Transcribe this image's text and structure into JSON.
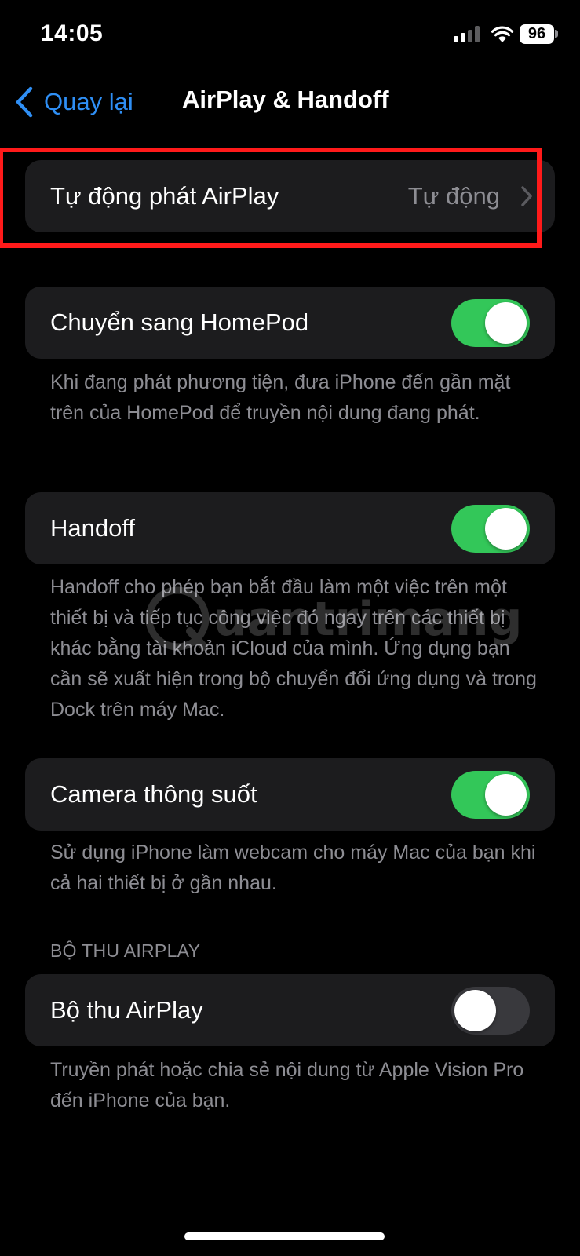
{
  "status_bar": {
    "time": "14:05",
    "battery": "96"
  },
  "nav": {
    "back_label": "Quay lại",
    "title": "AirPlay & Handoff"
  },
  "airplay_auto": {
    "label": "Tự động phát AirPlay",
    "value": "Tự động"
  },
  "homepod": {
    "label": "Chuyển sang HomePod",
    "enabled": true,
    "footer": "Khi đang phát phương tiện, đưa iPhone đến gần mặt trên của HomePod để truyền nội dung đang phát."
  },
  "handoff": {
    "label": "Handoff",
    "enabled": true,
    "footer": "Handoff cho phép bạn bắt đầu làm một việc trên một thiết bị và tiếp tục công việc đó ngay trên các thiết bị khác bằng tài khoản iCloud của mình. Ứng dụng bạn cần sẽ xuất hiện trong bộ chuyển đổi ứng dụng và trong Dock trên máy Mac."
  },
  "continuity_camera": {
    "label": "Camera thông suốt",
    "enabled": true,
    "footer": "Sử dụng iPhone làm webcam cho máy Mac của bạn khi cả hai thiết bị ở gần nhau."
  },
  "airplay_receiver": {
    "section_header": "BỘ THU AIRPLAY",
    "label": "Bộ thu AirPlay",
    "enabled": false,
    "footer": "Truyền phát hoặc chia sẻ nội dung từ Apple Vision Pro đến iPhone của bạn."
  },
  "watermark": {
    "text": "uantrimang"
  },
  "colors": {
    "accent": "#2f8ff5",
    "toggle_on": "#33c759",
    "toggle_off": "#39393d",
    "cell_background": "#1c1c1e",
    "secondary_text": "#8d8d93",
    "highlight_border": "#ff1a1a"
  },
  "icons": {
    "back": "chevron-left-icon",
    "disclosure": "chevron-right-icon",
    "signal": "cellular-signal-icon",
    "wifi": "wifi-icon",
    "battery": "battery-icon"
  }
}
